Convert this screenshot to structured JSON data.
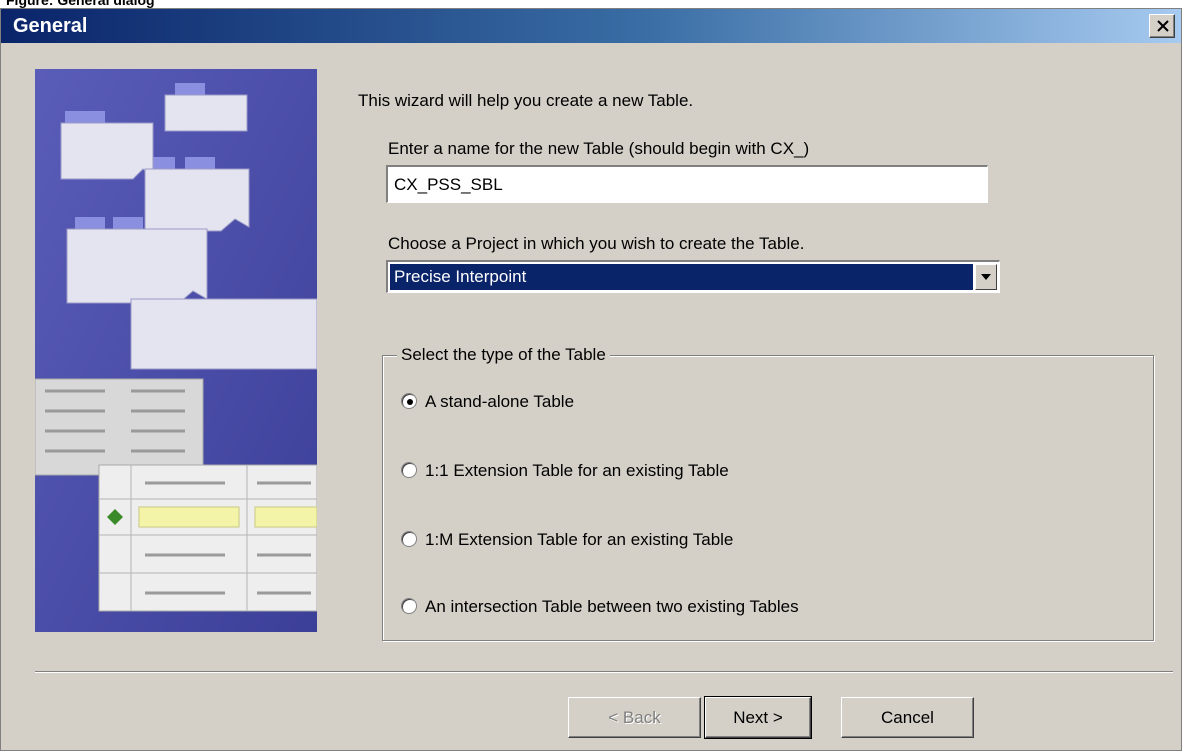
{
  "caption": "Figure: General dialog",
  "window": {
    "title": "General",
    "close_icon": "close-icon"
  },
  "wizard": {
    "intro": "This wizard will help you create a new Table.",
    "name_label": "Enter a name for the new Table (should begin with CX_)",
    "name_value": "CX_PSS_SBL",
    "project_label": "Choose a Project in which you wish to create the Table.",
    "project_value": "Precise Interpoint"
  },
  "table_type": {
    "legend": "Select the type of the Table",
    "options": [
      {
        "label": "A stand-alone Table",
        "selected": true
      },
      {
        "label": "1:1 Extension Table for an existing Table",
        "selected": false
      },
      {
        "label": "1:M Extension Table for an existing Table",
        "selected": false
      },
      {
        "label": "An intersection Table between two existing Tables",
        "selected": false
      }
    ]
  },
  "buttons": {
    "back": "< Back",
    "next": "Next >",
    "cancel": "Cancel"
  },
  "colors": {
    "titlebar_start": "#0a246a",
    "titlebar_end": "#a6caf0",
    "dialog_bg": "#d4d0c8",
    "selection": "#0a246a",
    "art_bg": "#4c4fa8"
  }
}
